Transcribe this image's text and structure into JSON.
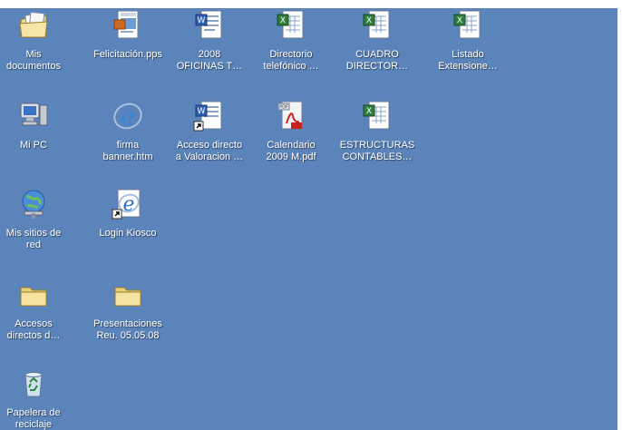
{
  "desktop": {
    "background_color": "#5b84bb",
    "icons": [
      {
        "label": "Mis\ndocumentos",
        "icon": "my-documents-icon"
      },
      {
        "label": "Felicitación.pps",
        "icon": "powerpoint-file-icon"
      },
      {
        "label": "2008\nOFICINAS T…",
        "icon": "word-document-icon"
      },
      {
        "label": "Directorio\ntelefónico …",
        "icon": "excel-file-icon"
      },
      {
        "label": "CUADRO\nDIRECTOR…",
        "icon": "excel-file-icon"
      },
      {
        "label": "Listado\nExtensione…",
        "icon": "excel-file-icon"
      },
      {
        "label": "Mi PC",
        "icon": "my-computer-icon"
      },
      {
        "label": "firma\nbanner.htm",
        "icon": "internet-explorer-icon"
      },
      {
        "label": "Acceso directo\na Valoracion …",
        "icon": "word-shortcut-icon"
      },
      {
        "label": "Calendario\n2009 M.pdf",
        "icon": "pdf-file-icon"
      },
      {
        "label": "ESTRUCTURAS\nCONTABLES…",
        "icon": "excel-file-icon"
      },
      {
        "label": "Mis sitios de\nred",
        "icon": "network-places-icon"
      },
      {
        "label": "Login Kiosco",
        "icon": "ie-shortcut-icon"
      },
      {
        "label": "Accesos\ndirectos d…",
        "icon": "folder-icon"
      },
      {
        "label": "Presentaciones\nReu. 05.05.08",
        "icon": "folder-icon"
      },
      {
        "label": "Papelera de\nreciclaje",
        "icon": "recycle-bin-icon"
      }
    ]
  }
}
